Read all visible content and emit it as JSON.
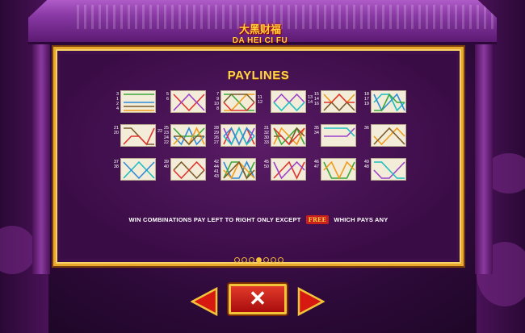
{
  "header": {
    "logo_cn": "大黑财福",
    "logo_en": "DA HEI CI FU"
  },
  "panel": {
    "title": "PAYLINES",
    "info_before": "WIN COMBINATIONS PAY LEFT TO RIGHT ONLY EXCEPT",
    "info_symbol": "FREE",
    "info_after": "WHICH PAYS ANY",
    "page_count": 7,
    "active_page": 4
  },
  "paylines": [
    {
      "labels_left": [
        "3",
        "1",
        "2",
        "4"
      ],
      "labels_right": []
    },
    {
      "labels_left": [
        "5",
        "6"
      ],
      "labels_right": []
    },
    {
      "labels_left": [
        "7",
        "9",
        "10",
        "8"
      ],
      "labels_right": [
        "11",
        "12"
      ]
    },
    {
      "labels_left": [],
      "labels_right": [
        "13",
        "14"
      ]
    },
    {
      "labels_left": [
        "15",
        "14",
        "16"
      ],
      "labels_right": []
    },
    {
      "labels_left": [
        "18",
        "17",
        "19"
      ],
      "labels_right": []
    },
    {
      "labels_left": [
        "21",
        "20"
      ],
      "labels_right": [
        "22"
      ]
    },
    {
      "labels_left": [
        "25",
        "23",
        "24",
        "22"
      ],
      "labels_right": []
    },
    {
      "labels_left": [
        "28",
        "29",
        "26",
        "27"
      ],
      "labels_right": []
    },
    {
      "labels_left": [
        "31",
        "32",
        "30",
        "33"
      ],
      "labels_right": []
    },
    {
      "labels_left": [
        "35",
        "34"
      ],
      "labels_right": []
    },
    {
      "labels_left": [
        "36"
      ],
      "labels_right": []
    },
    {
      "labels_left": [
        "37",
        "38"
      ],
      "labels_right": []
    },
    {
      "labels_left": [
        "39",
        "40"
      ],
      "labels_right": []
    },
    {
      "labels_left": [
        "42",
        "44",
        "41",
        "43"
      ],
      "labels_right": []
    },
    {
      "labels_left": [
        "45",
        "50"
      ],
      "labels_right": []
    },
    {
      "labels_left": [
        "46",
        "47"
      ],
      "labels_right": []
    },
    {
      "labels_left": [
        "49",
        "48"
      ],
      "labels_right": []
    }
  ],
  "buttons": {
    "close_symbol": "✕",
    "prev": "previous-page",
    "next": "next-page"
  },
  "colors": {
    "gold": "#ffd44a",
    "panel_bg": "#3e0f4a",
    "close_red": "#c8201a",
    "line_colors": [
      "#2e8bd8",
      "#e0332e",
      "#3aa83a",
      "#9b3fc9",
      "#f29a1c",
      "#1abfc2",
      "#7a5a2a"
    ]
  }
}
